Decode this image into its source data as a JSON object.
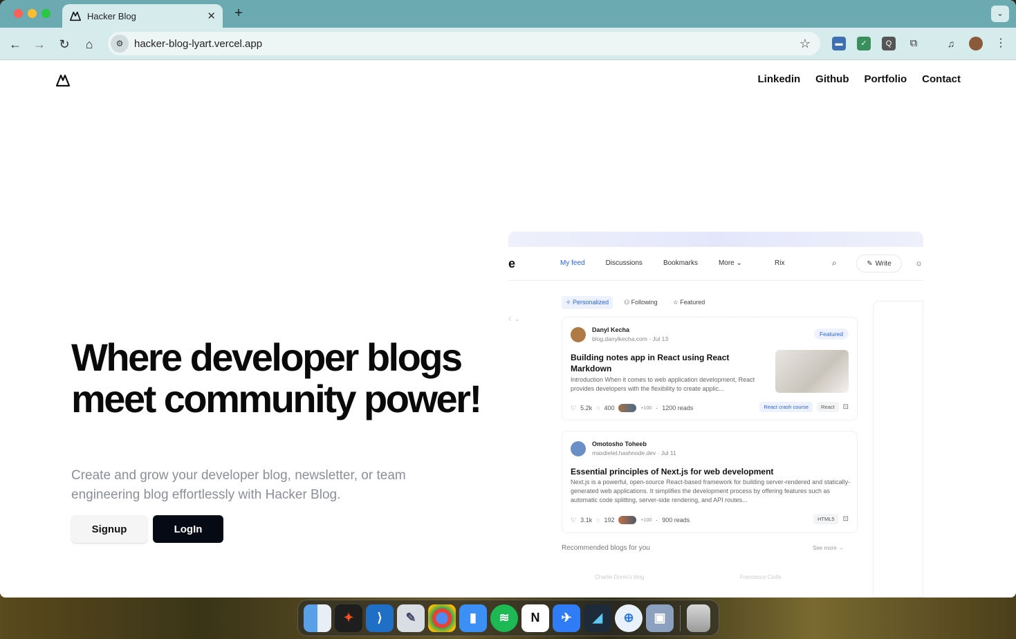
{
  "browser": {
    "tab_title": "Hacker Blog",
    "url": "hacker-blog-lyart.vercel.app",
    "new_tab": "+",
    "tab_close": "✕"
  },
  "site": {
    "nav": [
      "Linkedin",
      "Github",
      "Portfolio",
      "Contact"
    ],
    "hero_title": "Where developer blogs meet community power!",
    "hero_subtitle": "Create and grow your developer blog, newsletter, or team engineering blog effortlessly with Hacker Blog.",
    "signup_label": "Signup",
    "login_label": "LogIn"
  },
  "mockup": {
    "logo_fragment": "e",
    "nav": [
      "My feed",
      "Discussions",
      "Bookmarks",
      "More"
    ],
    "rix": "Rix",
    "write": "Write",
    "tabs": [
      "Personalized",
      "Following",
      "Featured"
    ],
    "posts": [
      {
        "author": "Danyl Kecha",
        "meta": "blog.danylkecha.com · Jul 13",
        "badge": "Featured",
        "title": "Building notes app in React using React Markdown",
        "body": "Introduction When it comes to web application development, React provides developers with the flexibility to create applic...",
        "likes": "5.2k",
        "comments": "400",
        "reads": "1200 reads",
        "extra": "+100",
        "tags": [
          "React crash course",
          "React"
        ]
      },
      {
        "author": "Omotosho Toheeb",
        "meta": "maxdietel.hashnode.dev · Jul 11",
        "title": "Essential principles of Next.js for web development",
        "body": "Next.js is a powerful, open-source React-based framework for building server-rendered and statically-generated web applications. It simplifies the development process by offering features such as automatic code splitting, server-side rendering, and API routes...",
        "likes": "3.1k",
        "comments": "192",
        "reads": "900 reads",
        "extra": "+100",
        "tags": [
          "HTML5"
        ]
      }
    ],
    "recommended": "Recommended blogs for you",
    "see_more": "See more",
    "rec_blogs": [
      "Charlie Donin's blog",
      "Francesco Ciulla"
    ]
  },
  "colors": {
    "tabbar": "#6aaab0",
    "toolbar": "#d6ebec",
    "accent": "#2563eb",
    "login_bg": "#050a14"
  }
}
